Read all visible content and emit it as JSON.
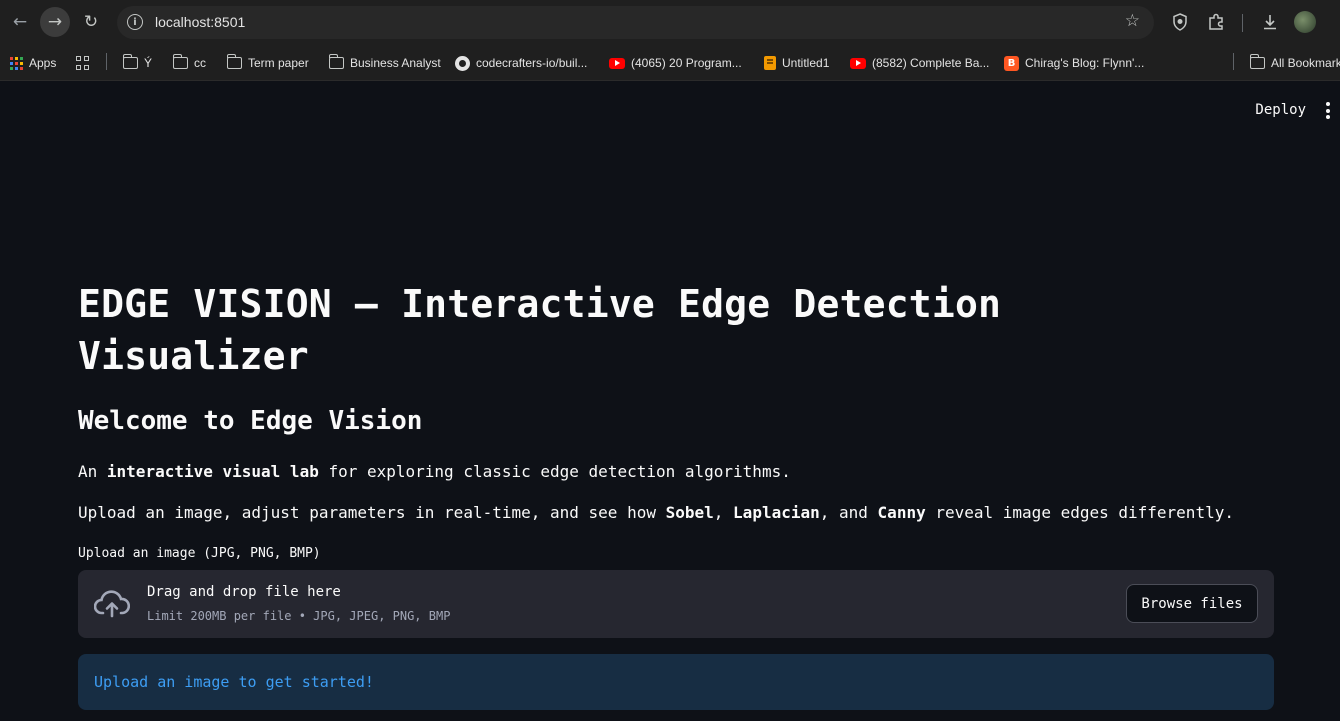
{
  "browser": {
    "url": "localhost:8501",
    "bookmarks": [
      {
        "label": "Apps",
        "icon": "apps-grid-icon"
      },
      {
        "label": "",
        "icon": "tab-groups-icon"
      },
      {
        "label": "Ý",
        "icon": "folder-icon"
      },
      {
        "label": "cc",
        "icon": "folder-icon"
      },
      {
        "label": "Term paper",
        "icon": "folder-icon"
      },
      {
        "label": "Business Analyst",
        "icon": "folder-icon"
      },
      {
        "label": "codecrafters-io/buil...",
        "icon": "github-icon"
      },
      {
        "label": "(4065) 20 Program...",
        "icon": "youtube-icon"
      },
      {
        "label": "Untitled1",
        "icon": "notebook-icon"
      },
      {
        "label": "(8582) Complete Ba...",
        "icon": "youtube-icon"
      },
      {
        "label": "Chirag's Blog: Flynn'...",
        "icon": "blogger-icon"
      },
      {
        "label": "All Bookmarks",
        "icon": "folder-icon"
      }
    ]
  },
  "app": {
    "deploy_label": "Deploy",
    "title": "EDGE VISION — Interactive Edge Detection Visualizer",
    "subtitle": "Welcome to Edge Vision",
    "intro": {
      "p1_a": "An ",
      "p1_b": "interactive visual lab",
      "p1_c": " for exploring classic edge detection algorithms.",
      "p2_a": "Upload an image, adjust parameters in real-time, and see how ",
      "p2_b": "Sobel",
      "p2_c": ", ",
      "p2_d": "Laplacian",
      "p2_e": ", and ",
      "p2_f": "Canny",
      "p2_g": " reveal image edges differently."
    },
    "uploader": {
      "label": "Upload an image (JPG, PNG, BMP)",
      "drop_text": "Drag and drop file here",
      "limit_text": "Limit 200MB per file • JPG, JPEG, PNG, BMP",
      "browse_label": "Browse files"
    },
    "info_message": "Upload an image to get started!"
  },
  "colors": {
    "background": "#0e1117",
    "dropzone": "#262730",
    "info_bg": "#172d43",
    "info_text": "#3d9df3"
  }
}
